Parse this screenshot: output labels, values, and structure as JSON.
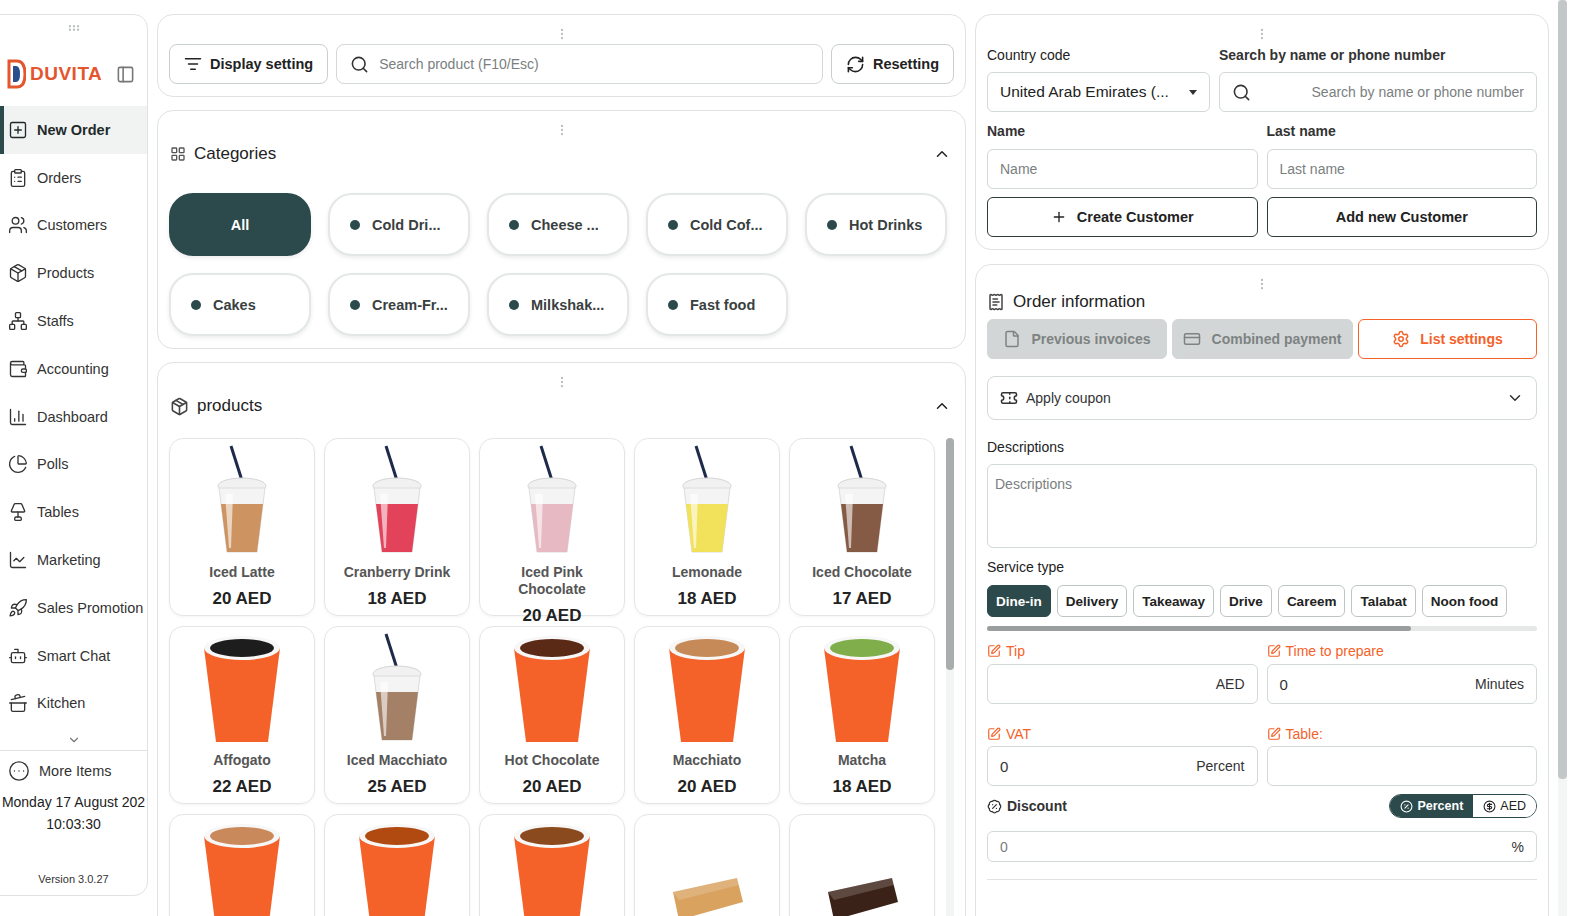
{
  "sidebar": {
    "logo": "DUVITA",
    "items": [
      {
        "label": "New Order",
        "selected": true
      },
      {
        "label": "Orders",
        "selected": false
      },
      {
        "label": "Customers",
        "selected": false
      },
      {
        "label": "Products",
        "selected": false
      },
      {
        "label": "Staffs",
        "selected": false
      },
      {
        "label": "Accounting",
        "selected": false
      },
      {
        "label": "Dashboard",
        "selected": false
      },
      {
        "label": "Polls",
        "selected": false
      },
      {
        "label": "Tables",
        "selected": false
      },
      {
        "label": "Marketing",
        "selected": false
      },
      {
        "label": "Sales Promotion",
        "selected": false
      },
      {
        "label": "Smart Chat",
        "selected": false
      },
      {
        "label": "Kitchen",
        "selected": false
      }
    ],
    "more": "More Items",
    "date": "Monday 17 August 202",
    "time": "10:03:30",
    "version": "Version 3.0.27"
  },
  "toolbar": {
    "display_setting": "Display setting",
    "search_placeholder": "Search product (F10/Esc)",
    "reset": "Resetting"
  },
  "categories": {
    "title": "Categories",
    "expanded": true,
    "items": [
      {
        "label": "All",
        "kind": "all",
        "selected": true
      },
      {
        "label": "Cold Dri...",
        "kind": "category",
        "selected": false
      },
      {
        "label": "Cheese ...",
        "kind": "category",
        "selected": false
      },
      {
        "label": "Cold Cof...",
        "kind": "category",
        "selected": false
      },
      {
        "label": "Hot Drinks",
        "kind": "category",
        "selected": false
      },
      {
        "label": "Cakes",
        "kind": "category",
        "selected": false
      },
      {
        "label": "Cream-Fr...",
        "kind": "category",
        "selected": false
      },
      {
        "label": "Milkshak...",
        "kind": "category",
        "selected": false
      },
      {
        "label": "Fast food",
        "kind": "category",
        "selected": false
      }
    ]
  },
  "products": {
    "title": "products",
    "expanded": true,
    "scroll_level": 0.47,
    "items": [
      {
        "name": "Iced Latte",
        "price": "20 AED",
        "kind": "iced",
        "color": "#c98a52"
      },
      {
        "name": "Cranberry Drink",
        "price": "18 AED",
        "kind": "iced",
        "color": "#e0304a"
      },
      {
        "name": "Iced Pink Chocolate",
        "price": "20 AED",
        "kind": "iced",
        "color": "#e6b3bd"
      },
      {
        "name": "Lemonade",
        "price": "18 AED",
        "kind": "iced",
        "color": "#f2df4a"
      },
      {
        "name": "Iced Chocolate",
        "price": "17 AED",
        "kind": "iced",
        "color": "#7a4a33"
      },
      {
        "name": "Affogato",
        "price": "22 AED",
        "kind": "hot",
        "color": "#1d1d1d"
      },
      {
        "name": "Iced Macchiato",
        "price": "25 AED",
        "kind": "iced",
        "color": "#9b7457"
      },
      {
        "name": "Hot Chocolate",
        "price": "20 AED",
        "kind": "hot",
        "color": "#5a2a17"
      },
      {
        "name": "Macchiato",
        "price": "20 AED",
        "kind": "hot",
        "color": "#c58a57"
      },
      {
        "name": "Matcha",
        "price": "18 AED",
        "kind": "hot",
        "color": "#7fae4a"
      }
    ],
    "partial": [
      {
        "kind": "hot",
        "color": "#c9895a"
      },
      {
        "kind": "hot",
        "color": "#b04a10"
      },
      {
        "kind": "hot",
        "color": "#8b4a1e"
      },
      {
        "kind": "cake",
        "color": "#d9a25e"
      },
      {
        "kind": "cake",
        "color": "#3b2218"
      }
    ]
  },
  "customer": {
    "country_label": "Country code",
    "country_value": "United Arab Emirates (...",
    "search_label": "Search by name or phone number",
    "search_placeholder": "Search by name or phone number",
    "name_label": "Name",
    "name_placeholder": "Name",
    "last_name_label": "Last name",
    "last_name_placeholder": "Last name",
    "buttons": [
      {
        "label": "Create Customer",
        "kind": "create"
      },
      {
        "label": "Add new Customer",
        "kind": "add"
      }
    ]
  },
  "order": {
    "title": "Order information",
    "actions": [
      {
        "label": "Previous invoices",
        "kind": "invoices",
        "disabled": true
      },
      {
        "label": "Combined payment",
        "kind": "payment",
        "disabled": true
      },
      {
        "label": "List settings",
        "kind": "settings",
        "disabled": false
      }
    ],
    "coupon": "Apply coupon",
    "descriptions_label": "Descriptions",
    "descriptions_placeholder": "Descriptions",
    "service_label": "Service type",
    "services": [
      {
        "label": "Dine-in",
        "selected": true
      },
      {
        "label": "Delivery",
        "selected": false
      },
      {
        "label": "Takeaway",
        "selected": false
      },
      {
        "label": "Drive",
        "selected": false
      },
      {
        "label": "Careem",
        "selected": false
      },
      {
        "label": "Talabat",
        "selected": false
      },
      {
        "label": "Noon food",
        "selected": false
      }
    ],
    "service_scroll_level": 0.77,
    "fields": [
      {
        "label": "Tip",
        "suffix": "AED"
      },
      {
        "label": "Time to prepare",
        "value": "0",
        "suffix": "Minutes"
      },
      {
        "label": "VAT",
        "value": "0",
        "suffix": "Percent"
      },
      {
        "label": "Table:"
      }
    ],
    "discount": {
      "label": "Discount",
      "units": [
        {
          "label": "Percent",
          "selected": true
        },
        {
          "label": "AED",
          "selected": false
        }
      ],
      "value": "0",
      "suffix": "%"
    }
  },
  "page_scroll_level": 0.85
}
